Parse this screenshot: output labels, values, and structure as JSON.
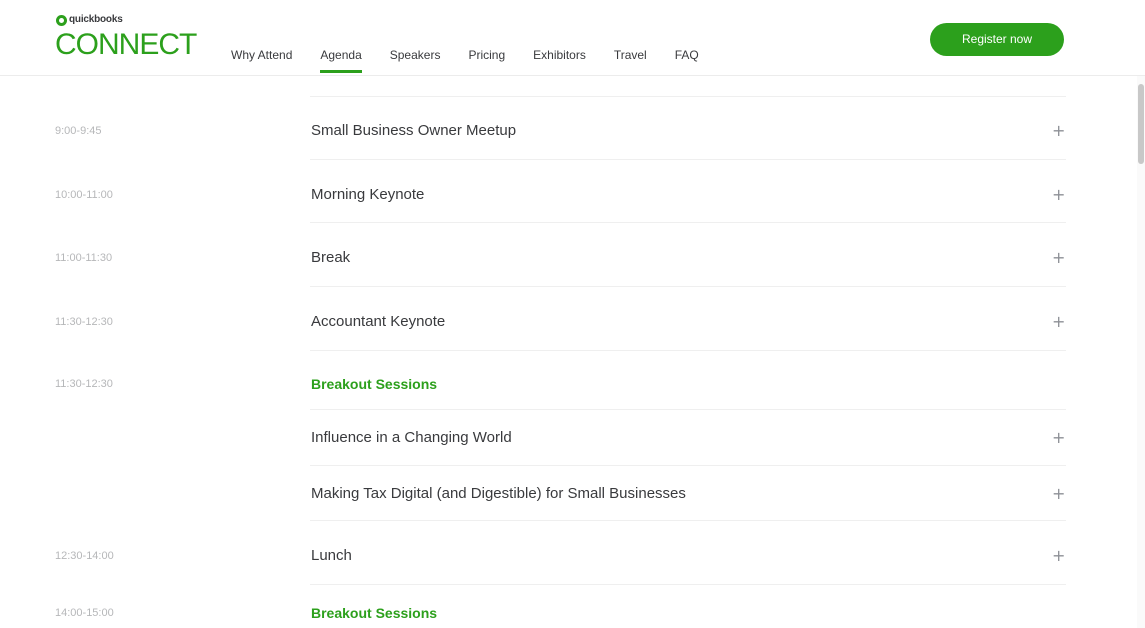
{
  "brand": {
    "small_text": "quickbooks",
    "big_text": "CONNECT",
    "accent_color": "#2ca01c"
  },
  "nav": {
    "items": [
      {
        "label": "Why Attend"
      },
      {
        "label": "Agenda"
      },
      {
        "label": "Speakers"
      },
      {
        "label": "Pricing"
      },
      {
        "label": "Exhibitors"
      },
      {
        "label": "Travel"
      },
      {
        "label": "FAQ"
      }
    ],
    "active": "Agenda"
  },
  "register_label": "Register now",
  "agenda": {
    "rows": [
      {
        "time": "9:00-9:45",
        "title": "Small Business Owner Meetup",
        "section": false,
        "expand": "+"
      },
      {
        "time": "10:00-11:00",
        "title": "Morning Keynote",
        "section": false,
        "expand": "+"
      },
      {
        "time": "11:00-11:30",
        "title": "Break",
        "section": false,
        "expand": "+"
      },
      {
        "time": "11:30-12:30",
        "title": "Accountant Keynote",
        "section": false,
        "expand": "+"
      },
      {
        "time": "11:30-12:30",
        "title": "Breakout Sessions",
        "section": true,
        "expand": ""
      },
      {
        "time": "",
        "title": "Influence in a Changing World",
        "section": false,
        "expand": "+"
      },
      {
        "time": "",
        "title": "Making Tax Digital (and Digestible) for Small Businesses",
        "section": false,
        "expand": "+"
      },
      {
        "time": "12:30-14:00",
        "title": "Lunch",
        "section": false,
        "expand": "+"
      },
      {
        "time": "14:00-15:00",
        "title": "Breakout Sessions",
        "section": true,
        "expand": ""
      }
    ]
  }
}
